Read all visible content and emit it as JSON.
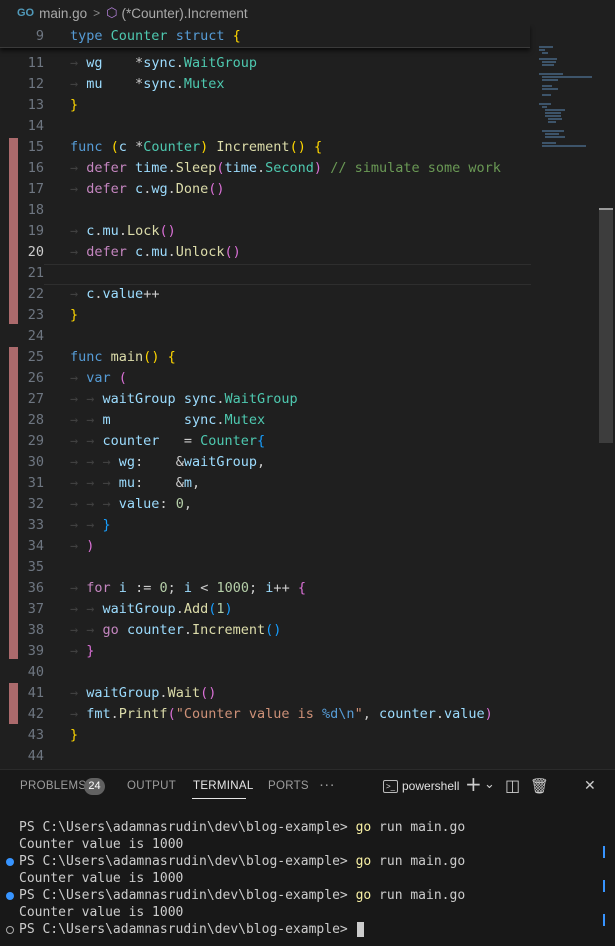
{
  "breadcrumb": {
    "file_icon": "GO",
    "file": "main.go",
    "separator": ">",
    "method_icon": "⬡",
    "symbol": "(*Counter).Increment"
  },
  "editor": {
    "sticky_line": {
      "num": "9",
      "text": "type Counter struct {"
    },
    "lines": [
      {
        "num": "11",
        "text": "wg    *sync.WaitGroup"
      },
      {
        "num": "12",
        "text": "mu    *sync.Mutex"
      },
      {
        "num": "13",
        "text": "}"
      },
      {
        "num": "14",
        "text": ""
      },
      {
        "num": "15",
        "text": "func (c *Counter) Increment() {"
      },
      {
        "num": "16",
        "text": "defer time.Sleep(time.Second) // simulate some work"
      },
      {
        "num": "17",
        "text": "defer c.wg.Done()"
      },
      {
        "num": "18",
        "text": ""
      },
      {
        "num": "19",
        "text": "c.mu.Lock()"
      },
      {
        "num": "20",
        "text": "defer c.mu.Unlock()"
      },
      {
        "num": "21",
        "text": ""
      },
      {
        "num": "22",
        "text": "c.value++"
      },
      {
        "num": "23",
        "text": "}"
      },
      {
        "num": "24",
        "text": ""
      },
      {
        "num": "25",
        "text": "func main() {"
      },
      {
        "num": "26",
        "text": "var ("
      },
      {
        "num": "27",
        "text": "waitGroup sync.WaitGroup"
      },
      {
        "num": "28",
        "text": "m         sync.Mutex"
      },
      {
        "num": "29",
        "text": "counter   = Counter{"
      },
      {
        "num": "30",
        "text": "wg:    &waitGroup,"
      },
      {
        "num": "31",
        "text": "mu:    &m,"
      },
      {
        "num": "32",
        "text": "value: 0,"
      },
      {
        "num": "33",
        "text": "}"
      },
      {
        "num": "34",
        "text": ")"
      },
      {
        "num": "35",
        "text": ""
      },
      {
        "num": "36",
        "text": "for i := 0; i < 1000; i++ {"
      },
      {
        "num": "37",
        "text": "waitGroup.Add(1)"
      },
      {
        "num": "38",
        "text": "go counter.Increment()"
      },
      {
        "num": "39",
        "text": "}"
      },
      {
        "num": "40",
        "text": ""
      },
      {
        "num": "41",
        "text": "waitGroup.Wait()"
      },
      {
        "num": "42",
        "text": "fmt.Printf(\"Counter value is %d\\n\", counter.value)"
      },
      {
        "num": "43",
        "text": "}"
      },
      {
        "num": "44",
        "text": ""
      }
    ],
    "active_line": "20"
  },
  "panel": {
    "tabs": {
      "problems": "PROBLEMS",
      "problems_count": "24",
      "output": "OUTPUT",
      "terminal": "TERMINAL",
      "ports": "PORTS",
      "more": "···"
    },
    "shell": {
      "icon": ">_",
      "name": "powershell"
    },
    "icons": {
      "add": "+",
      "dropdown": "⌄",
      "split": "◫",
      "trash": "🗑",
      "close": "✕"
    },
    "terminal": {
      "prompt": "PS C:\\Users\\adamnasrudin\\dev\\blog-example>",
      "go": "go",
      "command": "run main.go",
      "output": "Counter value is 1000"
    }
  }
}
